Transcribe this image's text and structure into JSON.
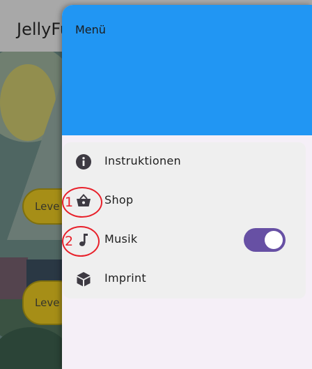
{
  "app": {
    "title": "JellyFu",
    "level_buttons": [
      "Leve",
      "Leve"
    ]
  },
  "drawer": {
    "header_title": "Menü",
    "header_color": "#2196f3",
    "items": [
      {
        "label": "Instruktionen",
        "icon": "info-icon"
      },
      {
        "label": "Shop",
        "icon": "basket-icon",
        "annotation": "1"
      },
      {
        "label": "Musik",
        "icon": "music-note-icon",
        "annotation": "2",
        "toggle_on": true
      },
      {
        "label": "Imprint",
        "icon": "cube-icon"
      }
    ]
  },
  "colors": {
    "toggle_track": "#6750a4",
    "annotation": "#e8202a"
  }
}
